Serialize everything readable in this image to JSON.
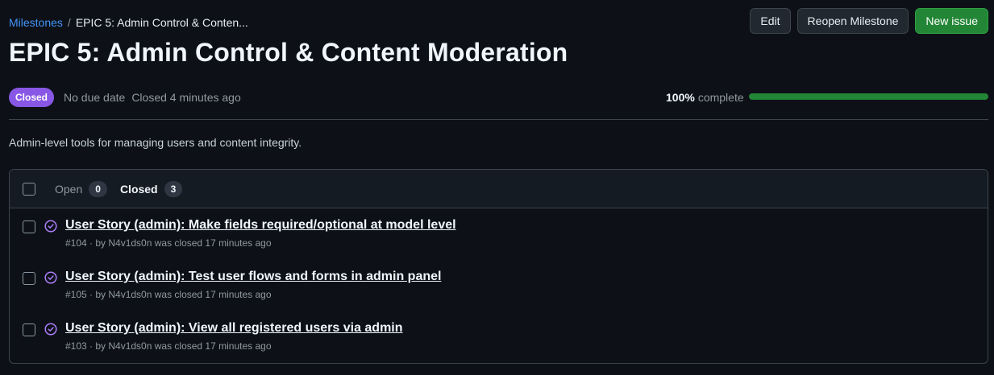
{
  "breadcrumb": {
    "parent": "Milestones",
    "separator": "/",
    "current": "EPIC 5: Admin Control & Conten..."
  },
  "actions": {
    "edit": "Edit",
    "reopen": "Reopen Milestone",
    "new_issue": "New issue"
  },
  "title": "EPIC 5: Admin Control & Content Moderation",
  "meta": {
    "status": "Closed",
    "due": "No due date",
    "closed": "Closed 4 minutes ago"
  },
  "progress": {
    "percent_label": "100%",
    "suffix": "complete",
    "value": 100,
    "color": "#238636"
  },
  "description": "Admin-level tools for managing users and content integrity.",
  "tabs": {
    "open_label": "Open",
    "open_count": "0",
    "closed_label": "Closed",
    "closed_count": "3"
  },
  "issues": [
    {
      "title": "User Story (admin): Make fields required/optional at model level",
      "sub": "#104 · by N4v1ds0n was closed 17 minutes ago"
    },
    {
      "title": "User Story (admin): Test user flows and forms in admin panel",
      "sub": "#105 · by N4v1ds0n was closed 17 minutes ago"
    },
    {
      "title": "User Story (admin): View all registered users via admin",
      "sub": "#103 · by N4v1ds0n was closed 17 minutes ago"
    }
  ],
  "colors": {
    "accent_link": "#4493f8",
    "closed_badge": "#8957e5",
    "primary_button": "#238636"
  }
}
